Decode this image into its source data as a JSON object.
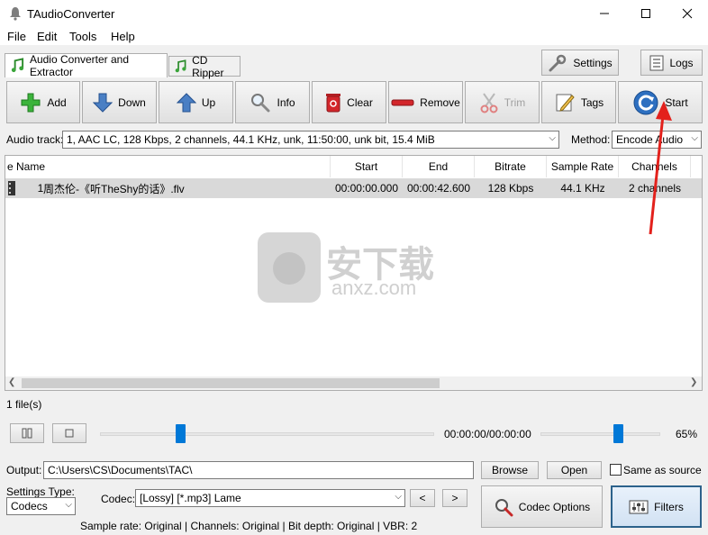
{
  "window": {
    "title": "TAudioConverter"
  },
  "menu": [
    "File",
    "Edit",
    "Tools",
    "Help"
  ],
  "tabs": [
    {
      "label": "Audio Converter and Extractor",
      "active": true
    },
    {
      "label": "CD Ripper",
      "active": false
    }
  ],
  "top_buttons": {
    "settings": "Settings",
    "logs": "Logs"
  },
  "toolbar": {
    "add": "Add",
    "down": "Down",
    "up": "Up",
    "info": "Info",
    "clear": "Clear",
    "remove": "Remove",
    "trim": "Trim",
    "tags": "Tags",
    "start": "Start"
  },
  "audio_track": {
    "label": "Audio track:",
    "value": "1, AAC LC, 128 Kbps, 2 channels, 44.1 KHz, unk, 11:50:00, unk bit, 15.4 MiB"
  },
  "method": {
    "label": "Method:",
    "value": "Encode Audio"
  },
  "file_list": {
    "columns": [
      "e Name",
      "Start",
      "End",
      "Bitrate",
      "Sample Rate",
      "Channels"
    ],
    "rows": [
      {
        "index": "1",
        "name": "周杰伦-《听TheShy的话》.flv",
        "start": "00:00:00.000",
        "end": "00:00:42.600",
        "bitrate": "128 Kbps",
        "sample_rate": "44.1 KHz",
        "channels": "2 channels"
      }
    ]
  },
  "watermark": {
    "text_cn": "安下载",
    "text_url": "anxz.com"
  },
  "file_count": "1 file(s)",
  "player": {
    "time": "00:00:00/00:00:00",
    "volume_label": "65%",
    "position_fraction": 0.24,
    "volume_fraction": 0.65
  },
  "output": {
    "label": "Output:",
    "path": "C:\\Users\\CS\\Documents\\TAC\\",
    "browse": "Browse",
    "open": "Open",
    "same_as_source": "Same as source"
  },
  "settings_type": {
    "label": "Settings Type:",
    "value": "Codecs"
  },
  "codec": {
    "label": "Codec:",
    "value": "[Lossy] [*.mp3] Lame",
    "prev": "<",
    "next": ">"
  },
  "codec_options": "Codec Options",
  "filters": "Filters",
  "status": "Sample rate: Original | Channels: Original | Bit depth: Original | VBR: 2",
  "colors": {
    "accent_blue": "#0078d7",
    "selection_gray": "#d9d9d9",
    "annotation_red": "#e3211c"
  }
}
